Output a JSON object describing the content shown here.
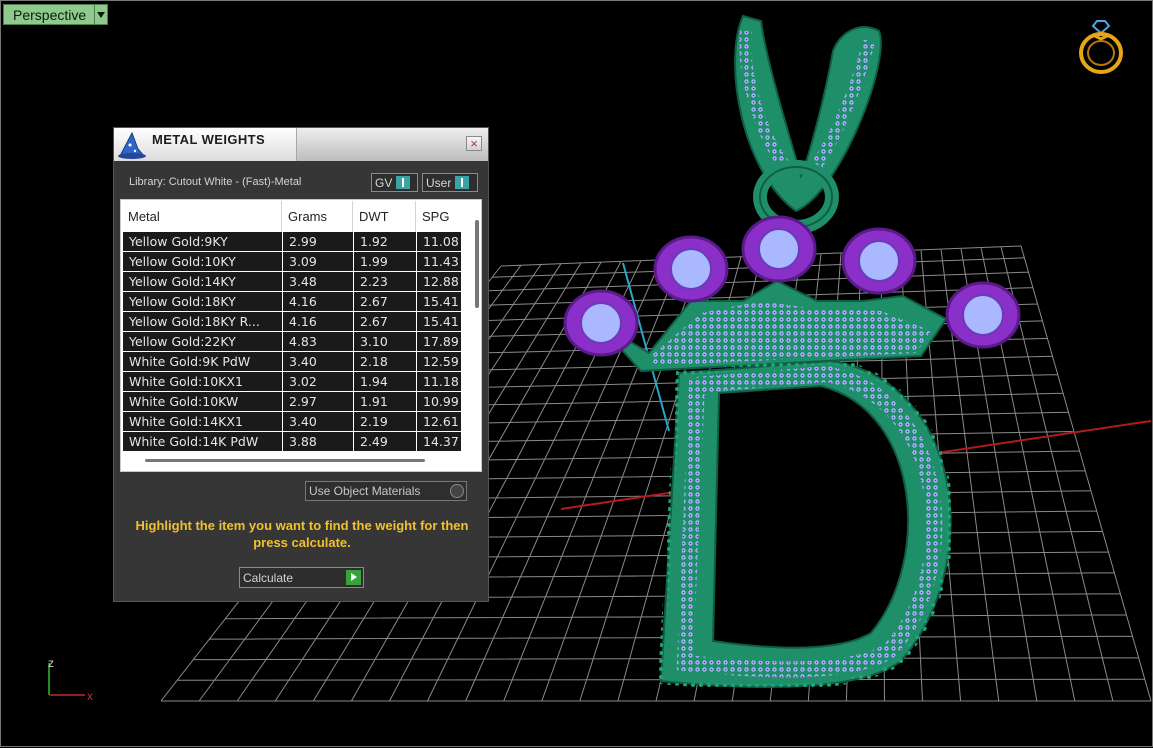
{
  "viewport": {
    "label": "Perspective",
    "axis": {
      "z": "z",
      "x": "x"
    }
  },
  "panel": {
    "title": "METAL WEIGHTS",
    "close_label": "×",
    "library_label": "Library: Cutout White - (Fast)-Metal",
    "toggles": [
      {
        "label": "GV"
      },
      {
        "label": "User"
      }
    ],
    "columns": [
      "Metal",
      "Grams",
      "DWT",
      "SPG"
    ],
    "rows": [
      {
        "metal": "Yellow Gold:9KY",
        "grams": "2.99",
        "dwt": "1.92",
        "spg": "11.08"
      },
      {
        "metal": "Yellow Gold:10KY",
        "grams": "3.09",
        "dwt": "1.99",
        "spg": "11.43"
      },
      {
        "metal": "Yellow Gold:14KY",
        "grams": "3.48",
        "dwt": "2.23",
        "spg": "12.88"
      },
      {
        "metal": "Yellow Gold:18KY",
        "grams": "4.16",
        "dwt": "2.67",
        "spg": "15.41"
      },
      {
        "metal": "Yellow Gold:18KY R...",
        "grams": "4.16",
        "dwt": "2.67",
        "spg": "15.41"
      },
      {
        "metal": "Yellow Gold:22KY",
        "grams": "4.83",
        "dwt": "3.10",
        "spg": "17.89"
      },
      {
        "metal": "White Gold:9K PdW",
        "grams": "3.40",
        "dwt": "2.18",
        "spg": "12.59"
      },
      {
        "metal": "White Gold:10KX1",
        "grams": "3.02",
        "dwt": "1.94",
        "spg": "11.18"
      },
      {
        "metal": "White Gold:10KW",
        "grams": "2.97",
        "dwt": "1.91",
        "spg": "10.99"
      },
      {
        "metal": "White Gold:14KX1",
        "grams": "3.40",
        "dwt": "2.19",
        "spg": "12.61"
      },
      {
        "metal": "White Gold:14K PdW",
        "grams": "3.88",
        "dwt": "2.49",
        "spg": "14.37"
      }
    ],
    "use_object_materials_label": "Use Object Materials",
    "hint": "Highlight the item you want to find the weight for then press calculate.",
    "calculate_label": "Calculate"
  },
  "colors": {
    "metal_green": "#1f8f6a",
    "stone_purple": "#8a2fc8",
    "stone_blue": "#9fb2ff",
    "hint_yellow": "#f2c02b",
    "grid_line": "#8a8a8a"
  }
}
